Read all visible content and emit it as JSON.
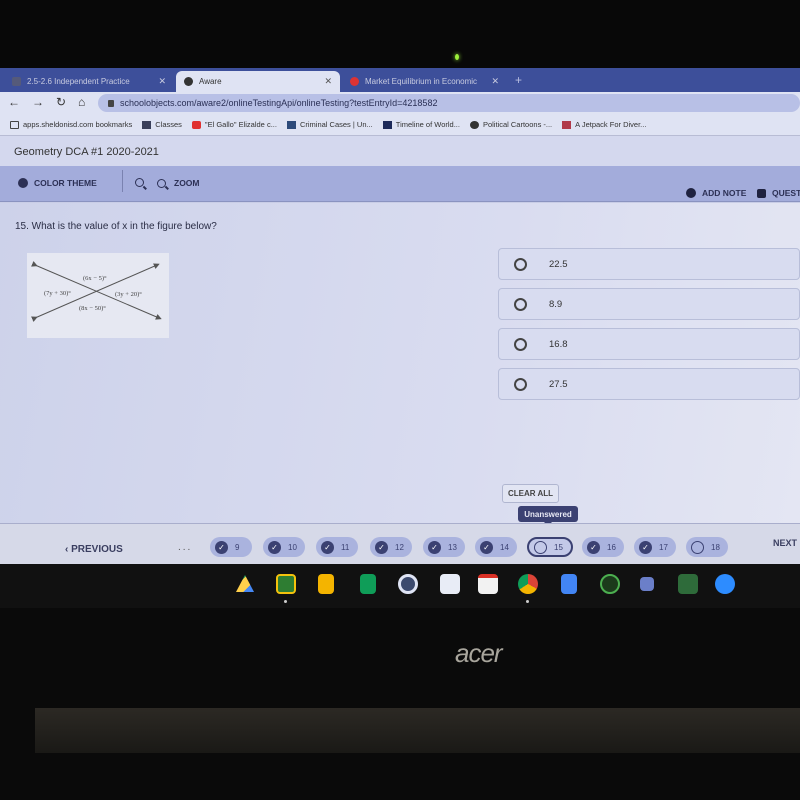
{
  "browser": {
    "tabs": [
      {
        "label": "2.5-2.6 Independent Practice",
        "icon": "doc-icon",
        "active": false
      },
      {
        "label": "Aware",
        "icon": "globe-icon",
        "active": true
      },
      {
        "label": "Market Equilibrium in Economic",
        "icon": "red-app-icon",
        "active": false
      }
    ],
    "url": "schoolobjects.com/aware2/onlineTestingApi/onlineTesting?testEntryId=4218582",
    "bookmarks": [
      {
        "label": "apps.sheldonisd.com bookmarks",
        "icon": "folder-icon"
      },
      {
        "label": "Classes",
        "icon": "classroom-icon"
      },
      {
        "label": "\"El Gallo\" Elizalde c...",
        "icon": "youtube-icon"
      },
      {
        "label": "Criminal Cases | Un...",
        "icon": "page-icon"
      },
      {
        "label": "Timeline of World...",
        "icon": "page-icon"
      },
      {
        "label": "Political Cartoons -...",
        "icon": "globe-icon"
      },
      {
        "label": "A Jetpack For Diver...",
        "icon": "image-icon"
      }
    ]
  },
  "app": {
    "title": "Geometry DCA #1 2020-2021",
    "toolbar": {
      "color_theme": "COLOR THEME",
      "zoom": "ZOOM",
      "add_note": "ADD NOTE",
      "question": "QUEST"
    }
  },
  "question": {
    "text": "15. What is the value of x in the figure below?",
    "figure_labels": {
      "top": "(6x − 5)°",
      "left": "(7y + 30)°",
      "right": "(3y + 20)°",
      "bottom": "(8x − 50)°"
    },
    "choices": [
      "22.5",
      "8.9",
      "16.8",
      "27.5"
    ],
    "clear_all": "CLEAR ALL"
  },
  "nav": {
    "previous": "PREVIOUS",
    "ellipsis": "...",
    "next": "NEXT",
    "tooltip": "Unanswered",
    "questions": [
      {
        "num": "9",
        "answered": true
      },
      {
        "num": "10",
        "answered": true
      },
      {
        "num": "11",
        "answered": true
      },
      {
        "num": "12",
        "answered": true
      },
      {
        "num": "13",
        "answered": true
      },
      {
        "num": "14",
        "answered": true
      },
      {
        "num": "15",
        "answered": false,
        "current": true
      },
      {
        "num": "16",
        "answered": true
      },
      {
        "num": "17",
        "answered": true
      },
      {
        "num": "18",
        "answered": false
      }
    ]
  },
  "shelf": {
    "apps": [
      "google-drive-icon",
      "google-classroom-icon",
      "google-slides-icon",
      "google-sheets-icon",
      "camera-icon",
      "app-icon",
      "gmail-icon",
      "chrome-icon",
      "google-docs-icon",
      "voice-icon",
      "app-icon",
      "desmos-icon",
      "zoom-icon"
    ]
  },
  "laptop": {
    "brand": "acer"
  }
}
